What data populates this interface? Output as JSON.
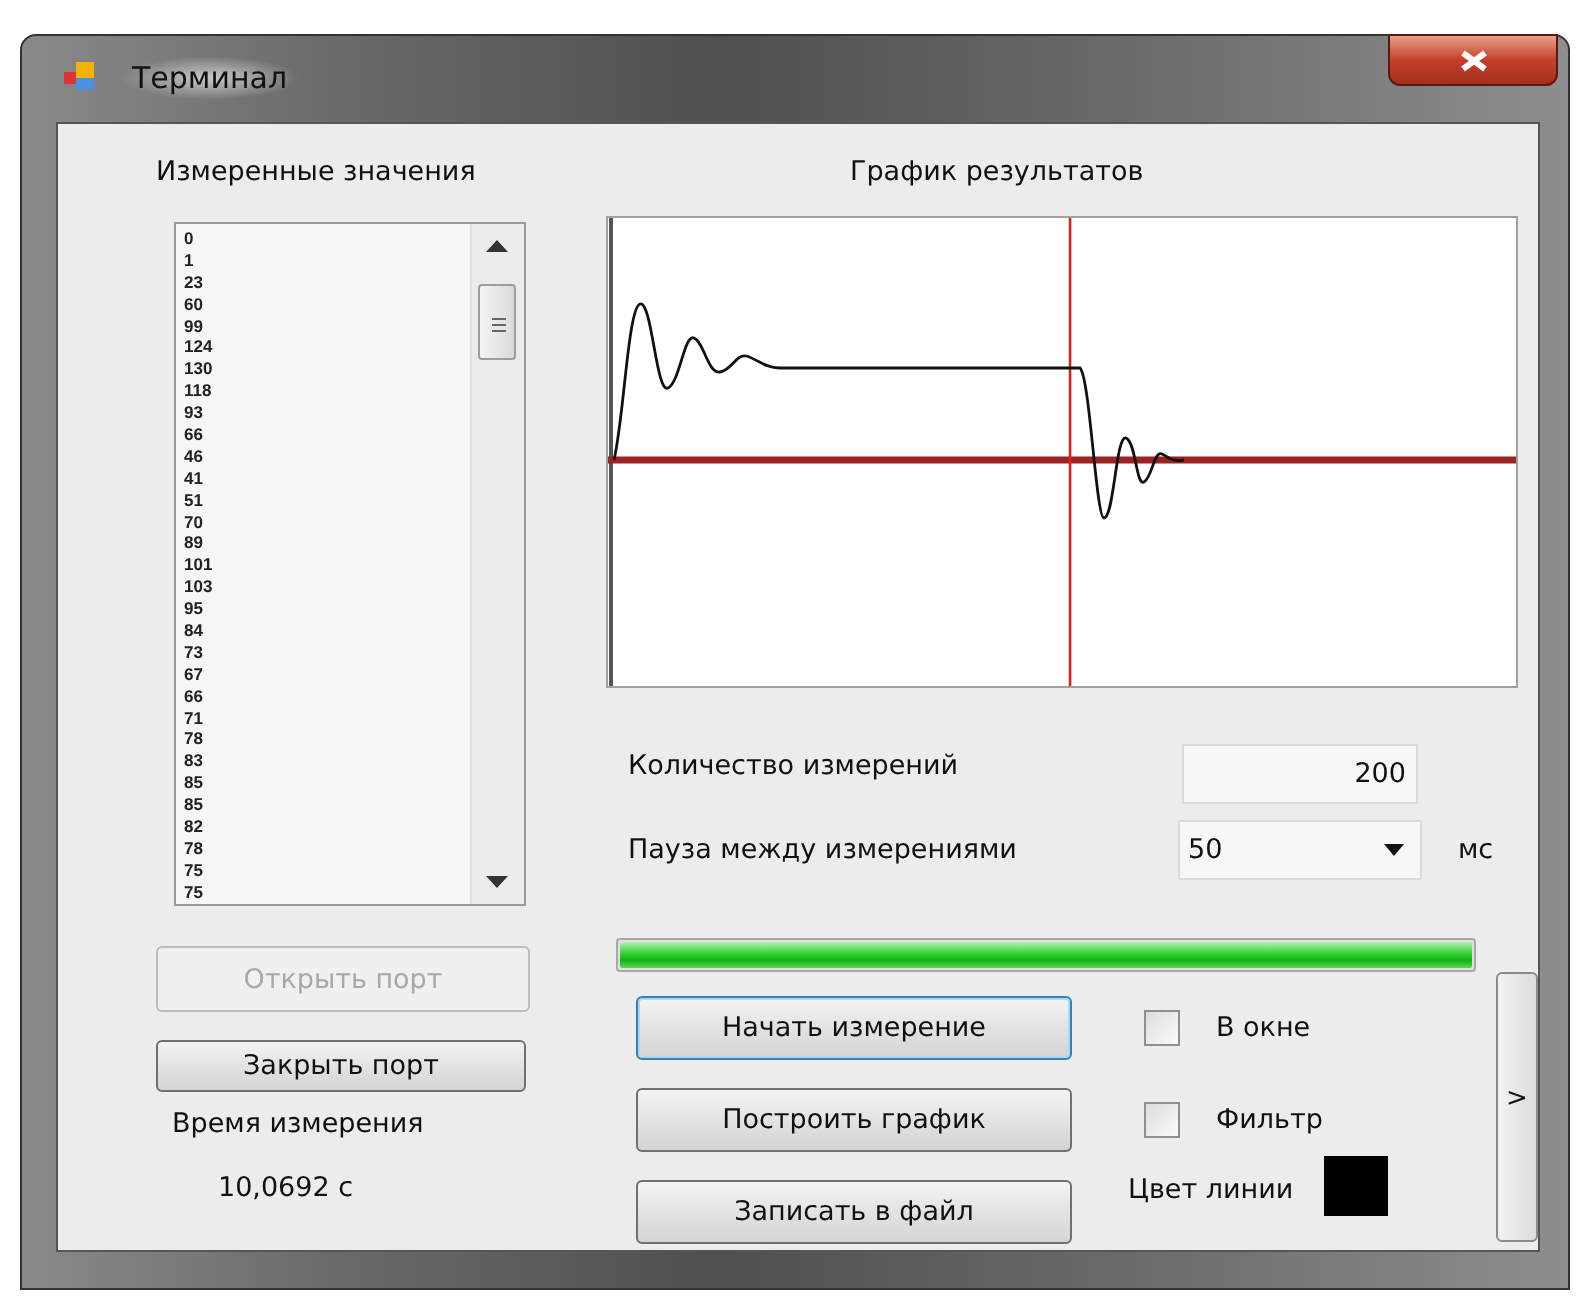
{
  "window": {
    "title": "Терминал"
  },
  "measured_values": {
    "heading": "Измеренные значения",
    "items": [
      "0",
      "1",
      "23",
      "60",
      "99",
      "124",
      "130",
      "118",
      "93",
      "66",
      "46",
      "41",
      "51",
      "70",
      "89",
      "101",
      "103",
      "95",
      "84",
      "73",
      "67",
      "66",
      "71",
      "78",
      "83",
      "85",
      "85",
      "82",
      "78",
      "75",
      "75"
    ]
  },
  "chart": {
    "title": "График результатов"
  },
  "port_buttons": [
    {
      "label": "Открыть порт",
      "disabled": true
    },
    {
      "label": "Закрыть порт",
      "disabled": false
    }
  ],
  "measure_time": {
    "label": "Время измерения",
    "value": "10,0692 с"
  },
  "count": {
    "label": "Количество измерений",
    "value": "200"
  },
  "pause": {
    "label": "Пауза между измерениями",
    "value": "50",
    "unit": "мс"
  },
  "progress": {
    "level": 1
  },
  "actions": [
    {
      "label": "Начать измерение",
      "focused": true
    },
    {
      "label": "Построить график",
      "focused": false
    },
    {
      "label": "Записать в файл",
      "focused": false
    }
  ],
  "options": [
    {
      "label": "В окне",
      "checked": false
    },
    {
      "label": "Фильтр",
      "checked": false
    }
  ],
  "line_color": {
    "label": "Цвет линии",
    "color": "#000000"
  },
  "side_button": {
    "label": ">"
  }
}
